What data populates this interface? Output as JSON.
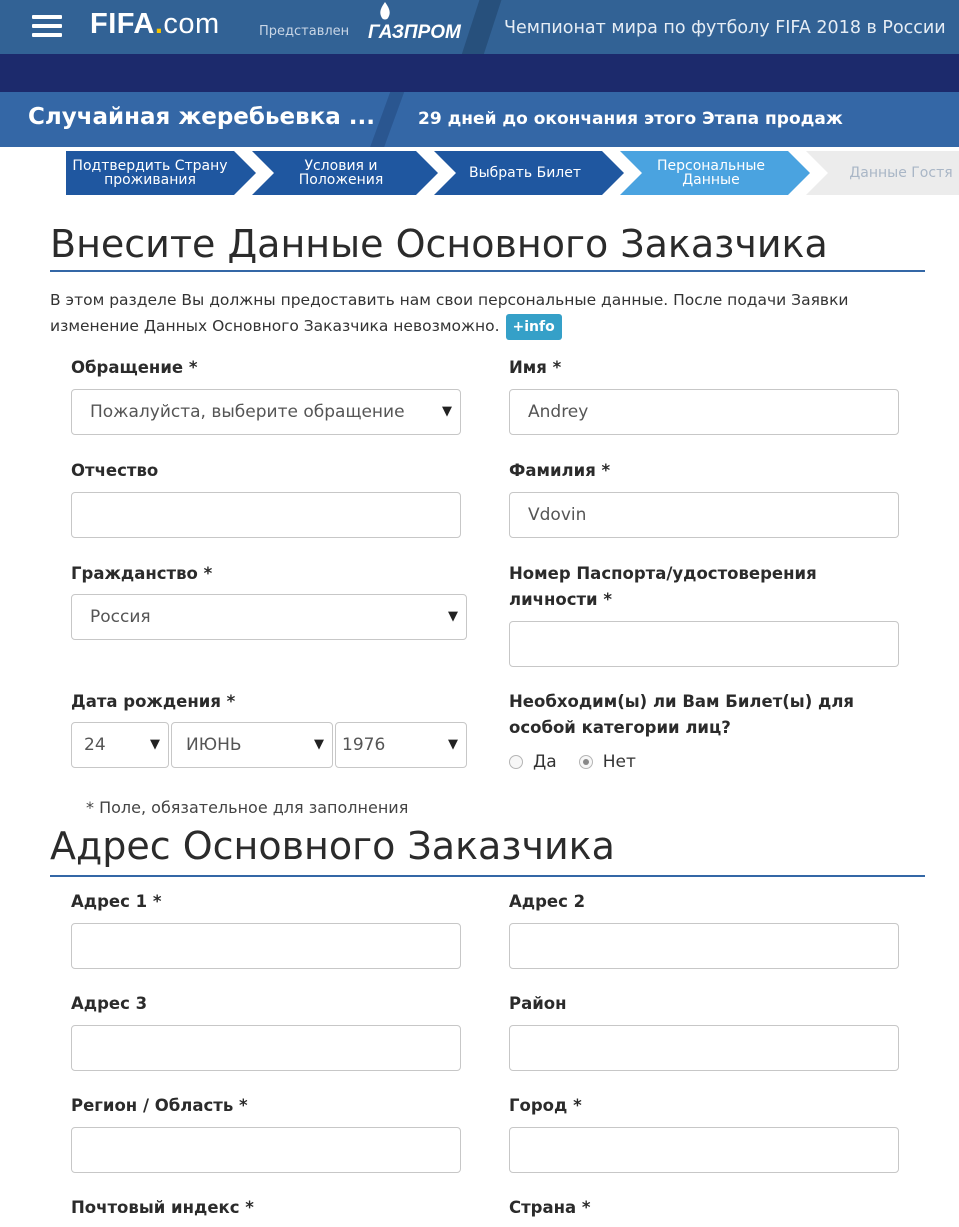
{
  "header": {
    "logo": {
      "brand": "FIFA",
      "dot": ".",
      "suffix": "com"
    },
    "presented_by": "Представлен",
    "sponsor": "ГАЗПРОМ",
    "event_title": "Чемпионат мира по футболу FIFA 2018 в России"
  },
  "subheader": {
    "title": "Случайная жеребьевка ...",
    "countdown": "29 дней до окончания этого Этапа продаж"
  },
  "steps": [
    {
      "line1": "Подтвердить Страну",
      "line2": "проживания"
    },
    {
      "line1": "Условия и",
      "line2": "Положения"
    },
    {
      "line1": "Выбрать Билет",
      "line2": ""
    },
    {
      "line1": "Персональные",
      "line2": "Данные"
    },
    {
      "line1": "Данные Гостя",
      "line2": ""
    }
  ],
  "section1": {
    "title": "Внесите Данные Основного Заказчика",
    "intro_line1": "В этом разделе Вы должны предоставить нам свои персональные данные. После подачи Заявки",
    "intro_line2": "изменение Данных Основного Заказчика невозможно.",
    "info_button": "+info"
  },
  "form": {
    "salutation": {
      "label": "Обращение *",
      "placeholder": "Пожалуйста, выберите обращение"
    },
    "first_name": {
      "label": "Имя *",
      "value": "Andrey"
    },
    "middle_name": {
      "label": "Отчество",
      "value": ""
    },
    "last_name": {
      "label": "Фамилия *",
      "value": "Vdovin"
    },
    "citizenship": {
      "label": "Гражданство *",
      "value": "Россия"
    },
    "passport": {
      "label_line1": "Номер Паспорта/удостоверения",
      "label_line2": "личности *",
      "value": ""
    },
    "birthdate": {
      "label": "Дата рождения *",
      "day": "24",
      "month": "ИЮНЬ",
      "year": "1976"
    },
    "special": {
      "label_line1": "Необходим(ы) ли Вам Билет(ы) для",
      "label_line2": "особой категории лиц?",
      "yes": "Да",
      "no": "Нет"
    },
    "required_note": "* Поле, обязательное для заполнения"
  },
  "section2": {
    "title": "Адрес Основного Заказчика",
    "address1": "Адрес 1 *",
    "address2": "Адрес 2",
    "address3": "Адрес 3",
    "district": "Район",
    "region": "Регион / Область *",
    "city": "Город *",
    "postcode": "Почтовый индекс *",
    "country": "Страна *"
  },
  "colors": {
    "primary": "#326295",
    "dark_band": "#1c2a6c",
    "step_active": "#4aa3e0",
    "step_done": "#1f57a0",
    "info": "#35a0c8"
  }
}
